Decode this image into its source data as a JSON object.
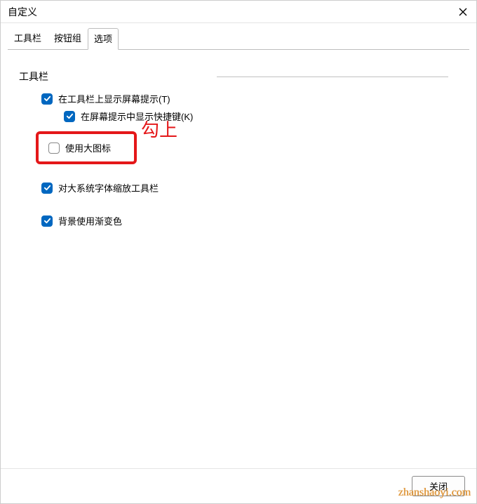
{
  "window": {
    "title": "自定义"
  },
  "tabs": {
    "items": [
      {
        "label": "工具栏"
      },
      {
        "label": "按钮组"
      },
      {
        "label": "选项"
      }
    ],
    "active_index": 2
  },
  "section": {
    "title": "工具栏"
  },
  "opts": {
    "show_tooltip": {
      "label": "在工具栏上显示屏幕提示(T)",
      "checked": true
    },
    "show_shortcut": {
      "label": "在屏幕提示中显示快捷键(K)",
      "checked": true
    },
    "large_icons": {
      "label": "使用大图标",
      "checked": false
    },
    "scale_toolbar": {
      "label": "对大系统字体缩放工具栏",
      "checked": true
    },
    "gradient_bg": {
      "label": "背景使用渐变色",
      "checked": true
    }
  },
  "annotation": {
    "text": "勾上"
  },
  "buttons": {
    "close": "关闭"
  },
  "watermark": "zhanshaoyi.com"
}
